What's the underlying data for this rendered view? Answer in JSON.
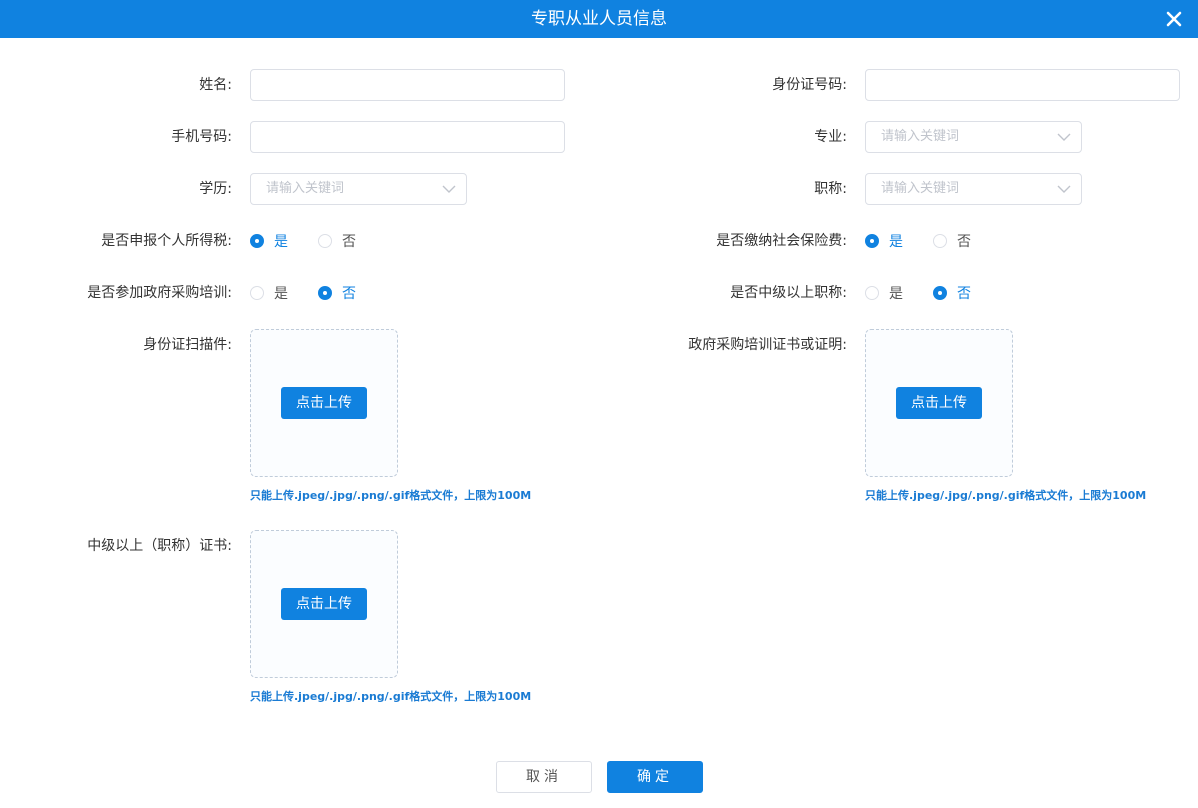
{
  "dialog": {
    "title": "专职从业人员信息",
    "accent_color": "#1082e0"
  },
  "form": {
    "name": {
      "label": "姓名:",
      "value": ""
    },
    "id_number": {
      "label": "身份证号码:",
      "value": ""
    },
    "phone": {
      "label": "手机号码:",
      "value": ""
    },
    "major": {
      "label": "专业:",
      "placeholder": "请输入关键词"
    },
    "education": {
      "label": "学历:",
      "placeholder": "请输入关键词"
    },
    "title": {
      "label": "职称:",
      "placeholder": "请输入关键词"
    },
    "income_tax": {
      "label": "是否申报个人所得税:",
      "yes": "是",
      "no": "否",
      "selected": "是"
    },
    "social_insurance": {
      "label": "是否缴纳社会保险费:",
      "yes": "是",
      "no": "否",
      "selected": "是"
    },
    "procurement_training": {
      "label": "是否参加政府采购培训:",
      "yes": "是",
      "no": "否",
      "selected": "否"
    },
    "mid_title": {
      "label": "是否中级以上职称:",
      "yes": "是",
      "no": "否",
      "selected": "否"
    },
    "id_scan": {
      "label": "身份证扫描件:",
      "button": "点击上传",
      "hint": "只能上传.jpeg/.jpg/.png/.gif格式文件，上限为100M"
    },
    "training_cert": {
      "label": "政府采购培训证书或证明:",
      "button": "点击上传",
      "hint": "只能上传.jpeg/.jpg/.png/.gif格式文件，上限为100M"
    },
    "mid_cert": {
      "label": "中级以上（职称）证书:",
      "button": "点击上传",
      "hint": "只能上传.jpeg/.jpg/.png/.gif格式文件，上限为100M"
    }
  },
  "footer": {
    "cancel": "取消",
    "confirm": "确定"
  },
  "icons": {
    "close": "close-icon",
    "dropdown": "chevron-down-icon"
  }
}
